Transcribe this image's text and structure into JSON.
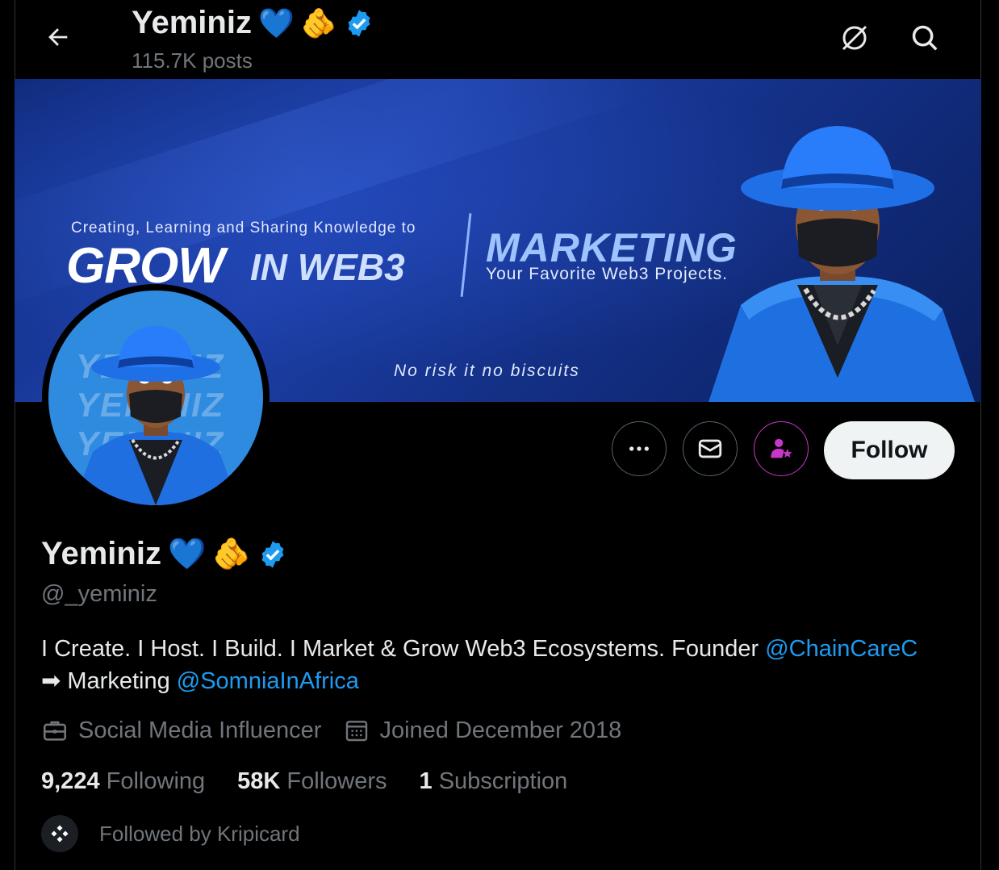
{
  "header": {
    "name": "Yeminiz",
    "emoji_heart": "💙",
    "emoji_point": "🫵",
    "posts_count": "115.7K posts",
    "back_icon": "arrow-left-icon",
    "grok_icon": "grok-icon",
    "search_icon": "search-icon"
  },
  "banner": {
    "small_line": "Creating, Learning and Sharing Knowledge to",
    "grow": "GROW",
    "in_web3": "IN WEB3",
    "marketing": "MARKETING",
    "favorite": "Your Favorite Web3 Projects.",
    "risk": "No risk it no biscuits"
  },
  "avatar": {
    "watermark": [
      "YEMINIZ",
      "YEMINIZ",
      "YEMINIZ"
    ]
  },
  "actions": {
    "more_icon": "more-icon",
    "message_icon": "mail-icon",
    "subscribe_icon": "person-star-icon",
    "follow_label": "Follow"
  },
  "profile": {
    "name": "Yeminiz",
    "emoji_heart": "💙",
    "emoji_point": "🫵",
    "handle": "@_yeminiz",
    "bio_text1": "I Create. I Host. I Build. I Market & Grow Web3 Ecosystems. Founder ",
    "bio_link1": "@ChainCareC",
    "bio_arrow": "➡",
    "bio_text2": " Marketing ",
    "bio_link2": "@SomniaInAfrica",
    "category": "Social Media Influencer",
    "joined": "Joined December 2018",
    "following_count": "9,224",
    "following_label": "Following",
    "followers_count": "58K",
    "followers_label": "Followers",
    "subscription_count": "1",
    "subscription_label": "Subscription",
    "followed_by": "Followed by Kripicard"
  },
  "colors": {
    "accent": "#1d9bf0",
    "verified": "#1d9bf0",
    "subscribe_ring": "#c936cc",
    "muted": "#71767b"
  }
}
